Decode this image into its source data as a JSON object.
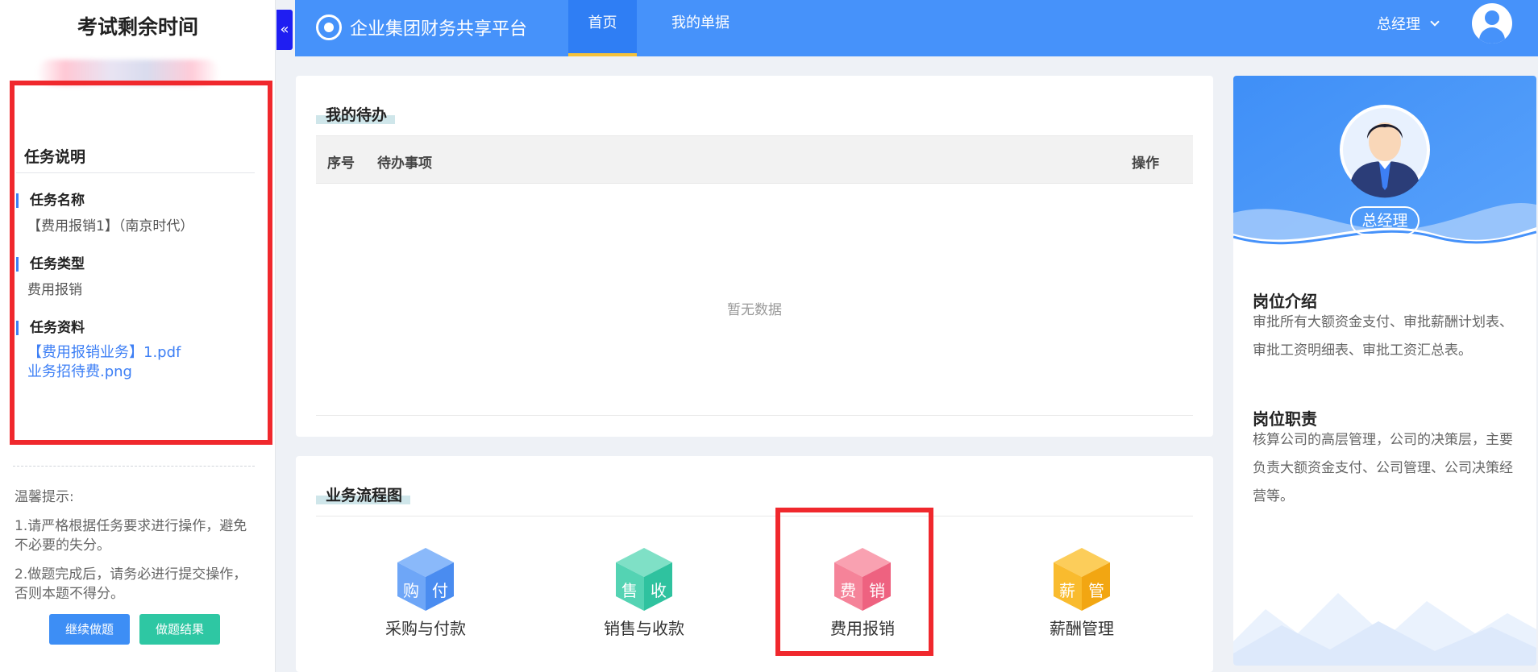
{
  "exam": {
    "timer_title": "考试剩余时间",
    "task_section_title": "任务说明",
    "task_name_label": "任务名称",
    "task_name_value": "【费用报销1】（南京时代）",
    "task_type_label": "任务类型",
    "task_type_value": "费用报销",
    "task_material_label": "任务资料",
    "task_materials": [
      "【费用报销业务】1.pdf",
      "业务招待费.png"
    ],
    "tips_title": "温馨提示:",
    "tips": [
      "1.请严格根据任务要求进行操作，避免不必要的失分。",
      "2.做题完成后，请务必进行提交操作，否则本题不得分。"
    ],
    "continue_button": "继续做题",
    "result_button": "做题结果"
  },
  "header": {
    "title": "企业集团财务共享平台",
    "nav": [
      "首页",
      "我的单据"
    ],
    "active_nav": "首页",
    "user_role": "总经理"
  },
  "todo": {
    "title": "我的待办",
    "columns": [
      "序号",
      "待办事项",
      "操作"
    ],
    "empty_text": "暂无数据"
  },
  "flow": {
    "title": "业务流程图",
    "items": [
      {
        "label": "采购与付款",
        "chars": [
          "购",
          "付"
        ],
        "color": "#5b9cf5"
      },
      {
        "label": "销售与收款",
        "chars": [
          "售",
          "收"
        ],
        "color": "#3fcfae"
      },
      {
        "label": "费用报销",
        "chars": [
          "费",
          "销"
        ],
        "color": "#f26f86"
      },
      {
        "label": "薪酬管理",
        "chars": [
          "薪",
          "管"
        ],
        "color": "#f7b52c"
      }
    ]
  },
  "profile": {
    "role": "总经理",
    "intro_title": "岗位介绍",
    "intro_text": "审批所有大额资金支付、审批薪酬计划表、审批工资明细表、审批工资汇总表。",
    "duty_title": "岗位职责",
    "duty_text": "核算公司的高层管理，公司的决策层，主要负责大额资金支付、公司管理、公司决策经营等。"
  },
  "colors": {
    "header_blue": "#4692fa",
    "highlight_red": "#f0282d",
    "link_blue": "#3d7ff5",
    "continue_blue": "#3d8ef5",
    "result_green": "#2ec7a3"
  }
}
